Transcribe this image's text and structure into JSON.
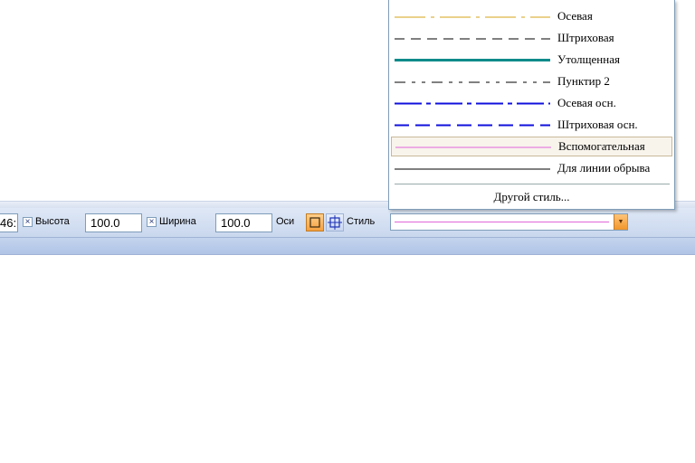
{
  "toolbar": {
    "left_field_value": "46:",
    "height_label": "Высота",
    "height_value": "100.0",
    "width_label": "Ширина",
    "width_value": "100.0",
    "axes_label": "Оси",
    "style_label": "Стиль",
    "checkbox_mark": "×"
  },
  "style_menu": {
    "items": [
      {
        "name": "Осевая",
        "line_color": "#d4a017"
      },
      {
        "name": "Штриховая",
        "line_color": "#000000"
      },
      {
        "name": "Утолщенная",
        "line_color": "#0f8a8a"
      },
      {
        "name": "Пунктир 2",
        "line_color": "#000000"
      },
      {
        "name": "Осевая осн.",
        "line_color": "#1010dd"
      },
      {
        "name": "Штриховая осн.",
        "line_color": "#1010dd"
      },
      {
        "name": "Вспомогательная",
        "line_color": "#e066d8"
      },
      {
        "name": "Для линии обрыва",
        "line_color": "#000000"
      }
    ],
    "other": "Другой стиль..."
  },
  "selected_style_color": "#e066d8"
}
